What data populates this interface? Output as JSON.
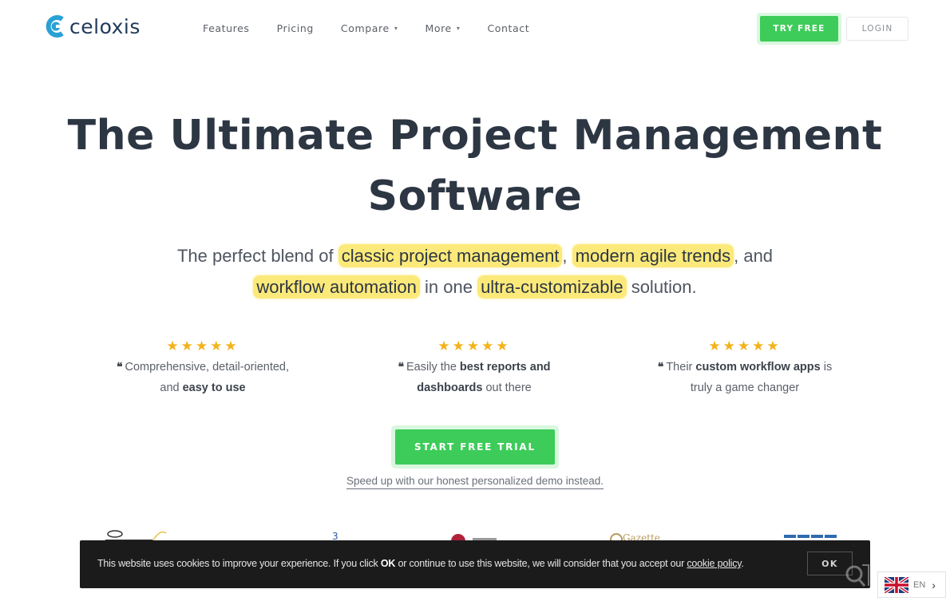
{
  "header": {
    "logo_text": "celoxis",
    "brand_color": "#2aa1d4",
    "nav": [
      {
        "label": "Features",
        "has_dropdown": false
      },
      {
        "label": "Pricing",
        "has_dropdown": false
      },
      {
        "label": "Compare",
        "has_dropdown": true
      },
      {
        "label": "More",
        "has_dropdown": true
      },
      {
        "label": "Contact",
        "has_dropdown": false
      }
    ],
    "try_free_label": "TRY FREE",
    "login_label": "LOGIN",
    "accent_color": "#3dcc59"
  },
  "hero": {
    "title_line1": "The Ultimate Project Management",
    "title_line2": "Software",
    "subtitle": {
      "part1": "The perfect blend of ",
      "hl1": "classic project management",
      "part2": ", ",
      "hl2": "modern agile trends",
      "part3": ", and",
      "hl3": "workflow automation",
      "part4": " in one ",
      "hl4": "ultra-customizable",
      "part5": " solution."
    },
    "highlight_color": "#fbe97a"
  },
  "testimonials": [
    {
      "stars": 5,
      "star_glyphs": "★★★★★",
      "quote_mark": "❝",
      "t1": "Comprehensive, detail-oriented,",
      "t2": "and ",
      "b1": "easy to use",
      "t3": ""
    },
    {
      "stars": 5,
      "star_glyphs": "★★★★★",
      "quote_mark": "❝",
      "t1": "Easily the ",
      "b1": "best reports and",
      "b2": "dashboards",
      "t2": " out there"
    },
    {
      "stars": 5,
      "star_glyphs": "★★★★★",
      "quote_mark": "❝",
      "t1": "Their ",
      "b1": "custom workflow apps",
      "t2": " is",
      "t3": "truly a game changer"
    }
  ],
  "cta": {
    "start_trial_label": "START FREE TRIAL",
    "demo_link_label": "Speed up with our honest personalized demo instead."
  },
  "cookie_banner": {
    "text1": "This website uses cookies to improve your experience. If you click ",
    "bold": "OK",
    "text2": " or continue to use this website, we will consider that you accept our ",
    "link": "cookie policy",
    "text3": ".",
    "ok_label": "OK"
  },
  "language": {
    "code": "EN",
    "flag": "uk-flag-icon"
  }
}
